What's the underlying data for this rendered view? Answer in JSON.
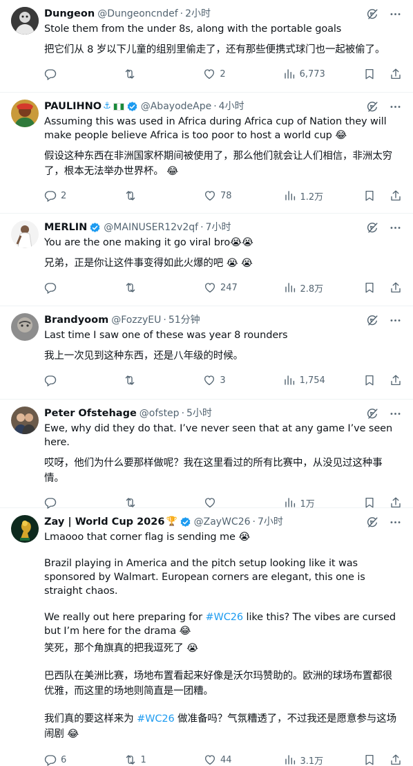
{
  "colors": {
    "text": "#0f1419",
    "muted": "#536471",
    "link": "#1d9bf0",
    "verified": "#1d9bf0",
    "divider": "#eff3f4"
  },
  "posts": [
    {
      "name": "Dungeon",
      "handle": "@Dungeoncndef",
      "time": "2小时",
      "verified": false,
      "text_en": "Stole them from the under 8s, along with the portable goals",
      "text_zh": "把它们从 8 岁以下儿童的组别里偷走了，还有那些便携式球门也一起被偷了。",
      "replies": "",
      "reposts": "",
      "likes": "2",
      "views": "6,773"
    },
    {
      "name": "PAULIHNO",
      "name_suffix": "⚓",
      "handle": "@AbayodeApe",
      "time": "4小时",
      "verified": true,
      "text_en": "Assuming this was used in Africa during Africa cup of Nation they will make people believe Africa is too poor to host a world cup 😂",
      "text_zh": "假设这种东西在非洲国家杯期间被使用了，那么他们就会让人们相信，非洲太穷了，根本无法举办世界杯。 😂",
      "replies": "2",
      "reposts": "",
      "likes": "78",
      "views": "1.2万"
    },
    {
      "name": "MERLIN",
      "handle": "@MAINUSER12v2qf",
      "time": "7小时",
      "verified": true,
      "text_en": "You are the one making it go viral bro😭😭",
      "text_zh": "兄弟，正是你让这件事变得如此火爆的吧 😭 😭",
      "replies": "",
      "reposts": "",
      "likes": "247",
      "views": "2.8万"
    },
    {
      "name": "Brandyoom",
      "handle": "@FozzyEU",
      "time": "51分钟",
      "verified": false,
      "text_en": "Last time I saw one of these was year 8 rounders",
      "text_zh": "我上一次见到这种东西，还是八年级的时候。",
      "replies": "",
      "reposts": "",
      "likes": "3",
      "views": "1,754"
    },
    {
      "name": "Peter Ofstehage",
      "handle": "@ofstep",
      "time": "5小时",
      "verified": false,
      "text_en": "Ewe, why did they do that. I’ve never seen that at any game I’ve seen here.",
      "text_zh": "哎呀，他们为什么要那样做呢？我在这里看过的所有比赛中，从没见过这种事情。",
      "replies": "",
      "reposts": "",
      "likes": "",
      "views": "1万"
    },
    {
      "name": "Zay | World Cup 2026",
      "name_suffix": "🏆",
      "handle": "@ZayWC26",
      "time": "7小时",
      "verified": true,
      "text_en_1": "Lmaooo that corner flag is sending me 😭",
      "text_en_2": "Brazil playing in America and the pitch setup looking like it was sponsored by Walmart. European corners are elegant, this one is straight chaos.",
      "text_en_3a": "We really out here preparing for ",
      "hashtag": "#WC26",
      "text_en_3b": " like this? The vibes are cursed but I’m here for the drama 😂",
      "text_zh_1": "笑死，那个角旗真的把我逗死了 😭",
      "text_zh_2": "巴西队在美洲比赛，场地布置看起来好像是沃尔玛赞助的。欧洲的球场布置都很优雅，而这里的场地则简直是一团糟。",
      "text_zh_3a": "我们真的要这样来为 ",
      "text_zh_3b": " 做准备吗？气氛糟透了，不过我还是愿意参与这场闹剧 😂",
      "replies": "6",
      "reposts": "1",
      "likes": "44",
      "views": "3.1万"
    }
  ]
}
